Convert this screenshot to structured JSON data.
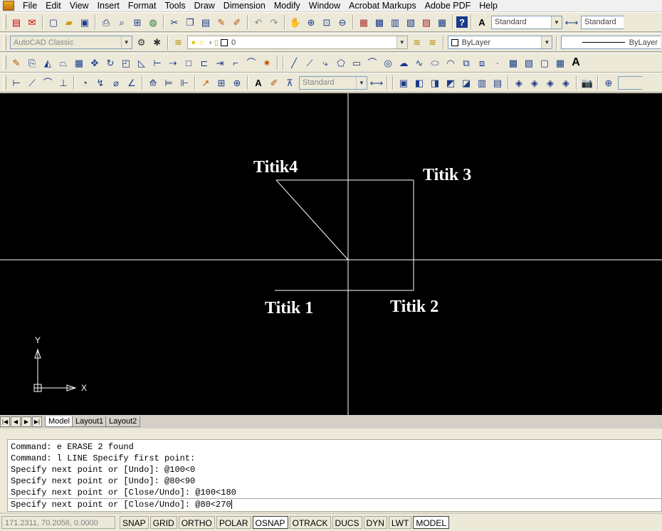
{
  "menu": [
    "File",
    "Edit",
    "View",
    "Insert",
    "Format",
    "Tools",
    "Draw",
    "Dimension",
    "Modify",
    "Window",
    "Acrobat Markups",
    "Adobe PDF",
    "Help"
  ],
  "toolbar": {
    "workspace": "AutoCAD Classic",
    "layer_value": "0",
    "color_value": "ByLayer",
    "linetype_value": "ByLayer",
    "text_style": "Standard",
    "dim_style": "Standard",
    "dim_style_2": "Standard",
    "text_icon": "A"
  },
  "drawing": {
    "labels": {
      "titik1": "Titik 1",
      "titik2": "Titik 2",
      "titik3": "Titik 3",
      "titik4": "Titik4"
    },
    "ucs_x": "X",
    "ucs_y": "Y",
    "line_color": "#ffffff",
    "background": "#000000"
  },
  "tabs": [
    "Model",
    "Layout1",
    "Layout2"
  ],
  "command": {
    "history": [
      "Command: e ERASE 2 found",
      "Command: l LINE Specify first point:",
      "Specify next point or [Undo]: @100<0",
      "Specify next point or [Undo]: @80<90",
      "Specify next point or [Close/Undo]: @100<180"
    ],
    "current": "Specify next point or [Close/Undo]: @80<270"
  },
  "status": {
    "coords": "171.2311, 70.2056, 0.0000",
    "toggles": [
      "SNAP",
      "GRID",
      "ORTHO",
      "POLAR",
      "OSNAP",
      "OTRACK",
      "DUCS",
      "DYN",
      "LWT",
      "MODEL"
    ]
  }
}
